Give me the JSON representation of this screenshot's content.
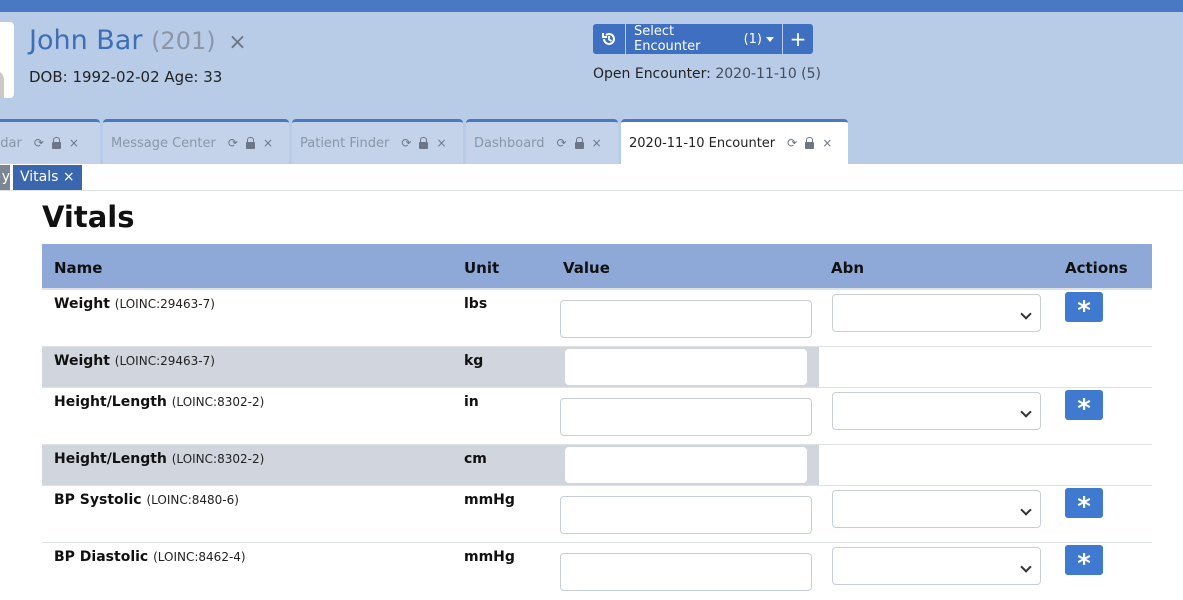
{
  "patient": {
    "name": "John Bar",
    "id": "(201)",
    "close_symbol": "×",
    "dob_line": "DOB: 1992-02-02 Age: 33"
  },
  "encounter": {
    "history_icon": "history-icon",
    "select_label": "Select Encounter",
    "select_count": "(1)",
    "add_symbol": "+",
    "open_label": "Open Encounter:",
    "open_value": "2020-11-10 (5)"
  },
  "tabs": [
    {
      "label": "ndar",
      "active": false
    },
    {
      "label": "Message Center",
      "active": false
    },
    {
      "label": "Patient Finder",
      "active": false
    },
    {
      "label": "Dashboard",
      "active": false
    },
    {
      "label": "2020-11-10 Encounter",
      "active": true
    }
  ],
  "tab_icons": {
    "refresh": "⟳",
    "close": "×"
  },
  "subtabs": {
    "prev_fragment": "y",
    "current": "Vitals ×"
  },
  "page": {
    "title": "Vitals"
  },
  "table": {
    "headers": {
      "name": "Name",
      "unit": "Unit",
      "value": "Value",
      "abn": "Abn",
      "actions": "Actions"
    },
    "rows": [
      {
        "name": "Weight",
        "code": "(LOINC:29463-7)",
        "unit": "lbs"
      },
      {
        "name": "Weight",
        "code": "(LOINC:29463-7)",
        "unit": "kg"
      },
      {
        "name": "Height/Length",
        "code": "(LOINC:8302-2)",
        "unit": "in"
      },
      {
        "name": "Height/Length",
        "code": "(LOINC:8302-2)",
        "unit": "cm"
      },
      {
        "name": "BP Systolic",
        "code": "(LOINC:8480-6)",
        "unit": "mmHg"
      },
      {
        "name": "BP Diastolic",
        "code": "(LOINC:8462-4)",
        "unit": "mmHg"
      }
    ],
    "action_symbol": "*"
  },
  "colors": {
    "accent": "#4a78c2",
    "header_bg": "#b8cce8",
    "table_header": "#8ea9d8",
    "action_button": "#3f7ad0"
  }
}
